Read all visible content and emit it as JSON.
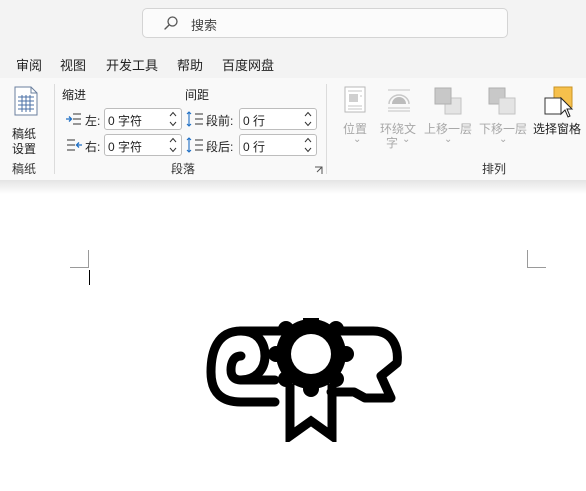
{
  "search": {
    "placeholder": "搜索"
  },
  "tabs": [
    "审阅",
    "视图",
    "开发工具",
    "帮助",
    "百度网盘"
  ],
  "ribbon": {
    "manuscript": {
      "button_line1": "稿纸",
      "button_line2": "设置",
      "group_label": "稿纸"
    },
    "indent": {
      "header": "缩进",
      "left_label": "左:",
      "left_value": "0 字符",
      "right_label": "右:",
      "right_value": "0 字符"
    },
    "spacing": {
      "header": "间距",
      "before_label": "段前:",
      "before_value": "0 行",
      "after_label": "段后:",
      "after_value": "0 行"
    },
    "paragraph_group_label": "段落",
    "arrange": {
      "position": "位置",
      "wrap_line1": "环绕文",
      "wrap_line2": "字",
      "bring_forward": "上移一层",
      "send_backward": "下移一层",
      "selection_pane": "选择窗格",
      "group_label": "排列"
    }
  },
  "colors": {
    "accent_yellow": "#f6c04c",
    "ribbon_bg": "#f9f9f9",
    "titlebar_bg": "#f3f3f3"
  },
  "document": {
    "icon": "diploma-scroll-icon"
  }
}
